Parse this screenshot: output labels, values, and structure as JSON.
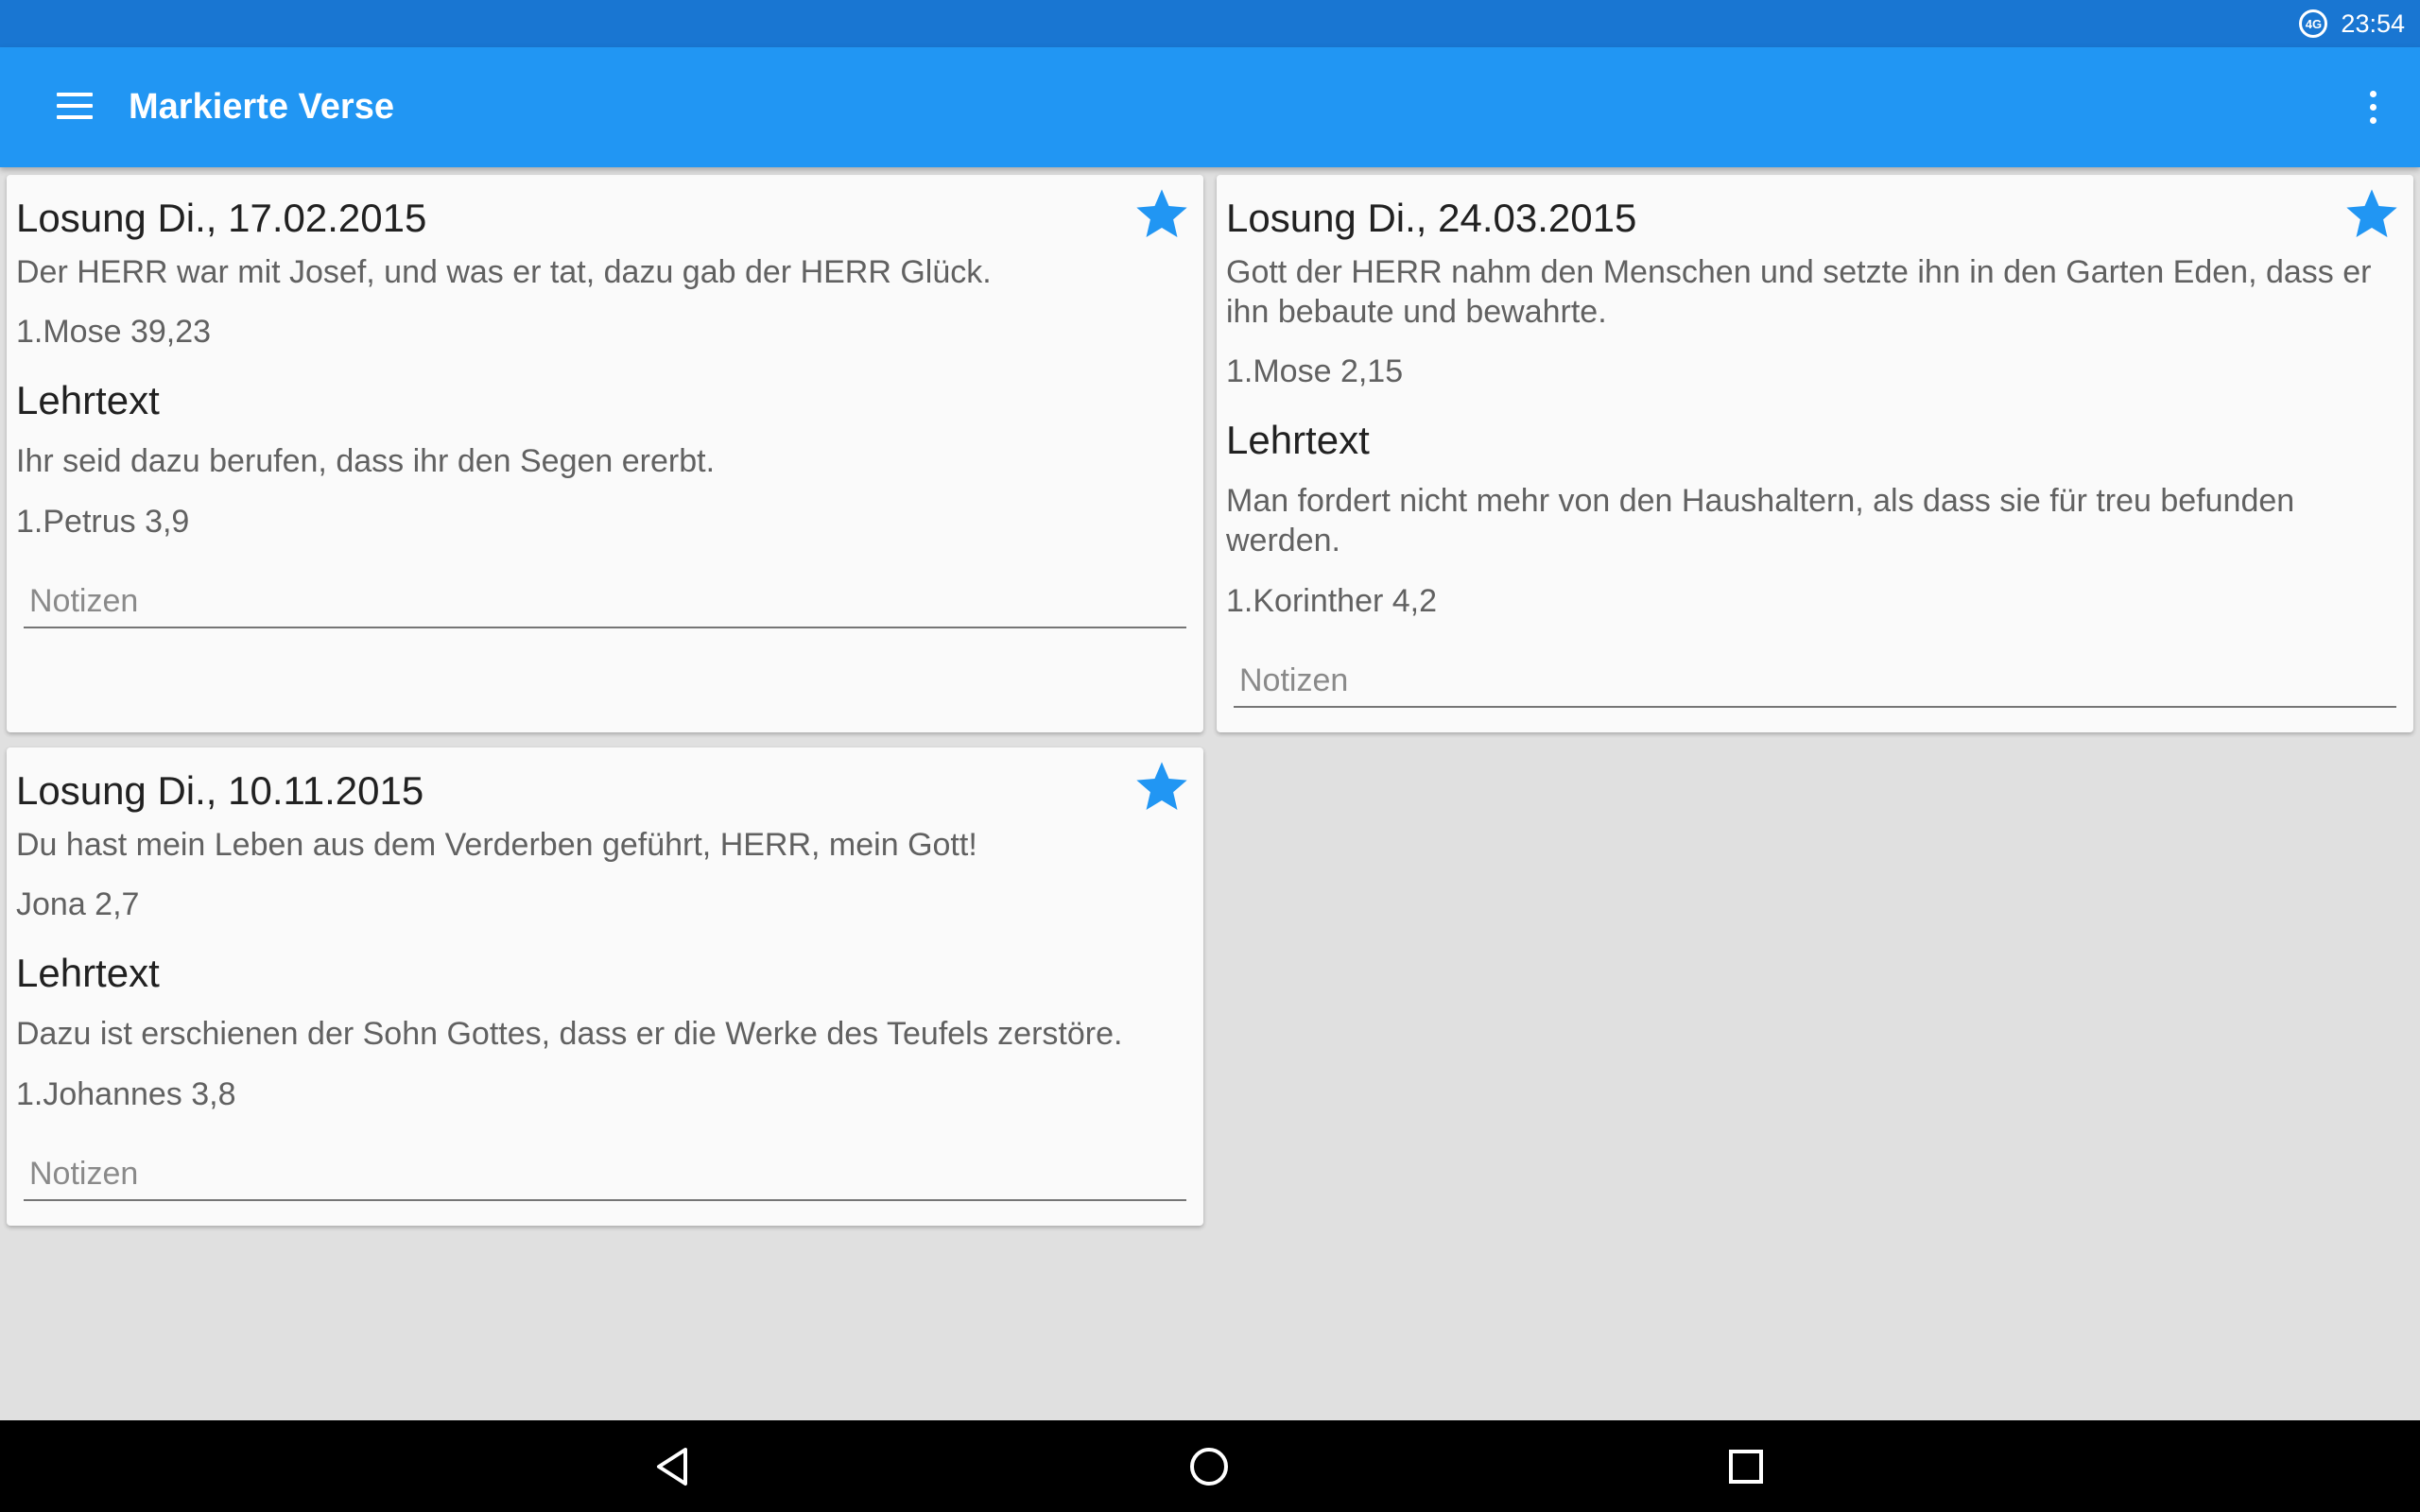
{
  "status_bar": {
    "time": "23:54",
    "data_icon_label": "4G",
    "data_icon": "data-saver-icon"
  },
  "app_bar": {
    "title": "Markierte Verse",
    "menu_icon": "hamburger-menu-icon",
    "overflow_icon": "more-vert-icon"
  },
  "colors": {
    "accent": "#2196f3",
    "status_bar": "#1976d2",
    "background": "#e0e0e0",
    "card": "#fafafa",
    "star": "#2196f3"
  },
  "cards": [
    {
      "title": "Losung Di., 17.02.2015",
      "losung_text": "Der HERR war mit Josef, und was er tat, dazu gab der HERR Glück.",
      "losung_ref": "1.Mose 39,23",
      "lehrtext_heading": "Lehrtext",
      "lehrtext_text": "Ihr seid dazu berufen, dass ihr den Segen ererbt.",
      "lehrtext_ref": "1.Petrus 3,9",
      "notes_placeholder": "Notizen",
      "notes_value": "",
      "starred": true
    },
    {
      "title": "Losung Di., 24.03.2015",
      "losung_text": "Gott der HERR nahm den Menschen und setzte ihn in den Garten Eden, dass er ihn bebaute und bewahrte.",
      "losung_ref": "1.Mose 2,15",
      "lehrtext_heading": "Lehrtext",
      "lehrtext_text": "Man fordert nicht mehr von den Haushaltern, als dass sie für treu befunden werden.",
      "lehrtext_ref": "1.Korinther 4,2",
      "notes_placeholder": "Notizen",
      "notes_value": "",
      "starred": true
    },
    {
      "title": "Losung Di., 10.11.2015",
      "losung_text": "Du hast mein Leben aus dem Verderben geführt, HERR, mein Gott!",
      "losung_ref": "Jona 2,7",
      "lehrtext_heading": "Lehrtext",
      "lehrtext_text": "Dazu ist erschienen der Sohn Gottes, dass er die Werke des Teufels zerstöre.",
      "lehrtext_ref": "1.Johannes 3,8",
      "notes_placeholder": "Notizen",
      "notes_value": "",
      "starred": true
    }
  ],
  "nav_bar": {
    "back_icon": "back-triangle-icon",
    "home_icon": "home-circle-icon",
    "recents_icon": "recents-square-icon"
  }
}
